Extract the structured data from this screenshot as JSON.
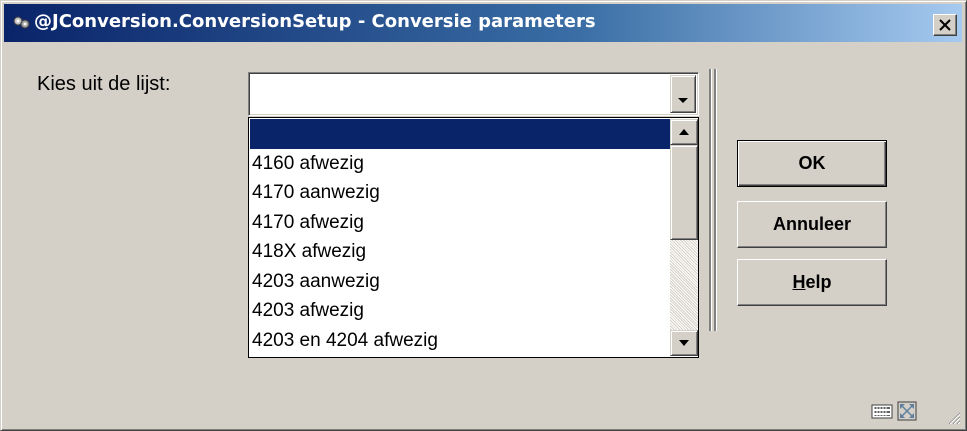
{
  "window": {
    "title": "@JConversion.ConversionSetup - Conversie parameters"
  },
  "form": {
    "label": "Kies uit de lijst:",
    "selected_value": ""
  },
  "list": {
    "items": [
      "",
      "4160 afwezig",
      "4170 aanwezig",
      "4170 afwezig",
      "418X afwezig",
      "4203 aanwezig",
      "4203 afwezig",
      "4203 en 4204 afwezig"
    ],
    "selected_index": 0
  },
  "buttons": {
    "ok": "OK",
    "cancel": "Annuleer",
    "help_mnemonic": "H",
    "help_rest": "elp"
  },
  "colors": {
    "selection": "#0a246a",
    "face": "#d4d0c8",
    "title_start": "#0a246a",
    "title_end": "#a6caf0"
  },
  "icons": {
    "app": "app-icon",
    "close": "close-icon",
    "status1": "keyboard-icon",
    "status2": "maximize-icon",
    "grip": "resize-grip-icon"
  }
}
